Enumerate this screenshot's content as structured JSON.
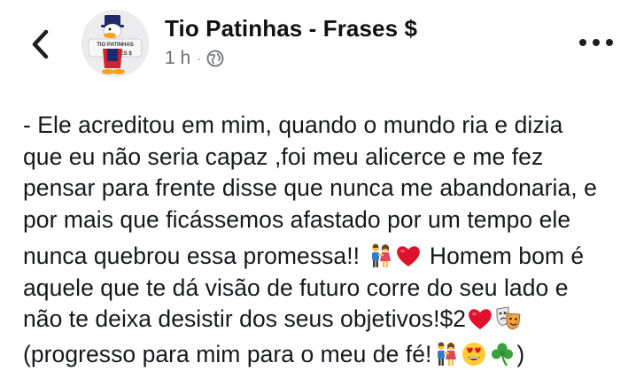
{
  "header": {
    "page_name": "Tio Patinhas - Frases $",
    "time": "1 h",
    "separator": "·",
    "privacy_icon": "globe-icon",
    "back_icon": "chevron-left-icon",
    "more_icon": "more-horizontal-icon",
    "avatar_text_top": "TIO PATINHAS",
    "avatar_text_bottom": "FRASES $"
  },
  "post": {
    "lines": [
      "- Ele acreditou em mim, quando o mundo ria e dizia",
      "que eu não seria capaz ,foi meu alicerce e me fez",
      "pensar para frente disse que nunca me abandonaria, e",
      "por mais que ficássemos afastado por um tempo ele"
    ],
    "line5_text": "nunca quebrou essa promessa!! ",
    "line5_tail": " Homem bom é",
    "line6": "aquele que te dá visão de futuro corre do seu lado e",
    "line7_text": "não te deixa desistir dos seus objetivos!$2",
    "line8_text": "(progresso para mim para o meu de fé!",
    "line8_end": ")",
    "emojis": [
      "couple-emoji",
      "red-heart-emoji",
      "red-heart-emoji",
      "performing-arts-emoji",
      "couple-emoji",
      "heart-eyes-emoji",
      "shamrock-emoji"
    ]
  },
  "colors": {
    "text": "#16181b",
    "meta": "#6b6f76",
    "heart": "#e0112b",
    "shamrock": "#3aa23a",
    "face": "#ffcc33"
  }
}
